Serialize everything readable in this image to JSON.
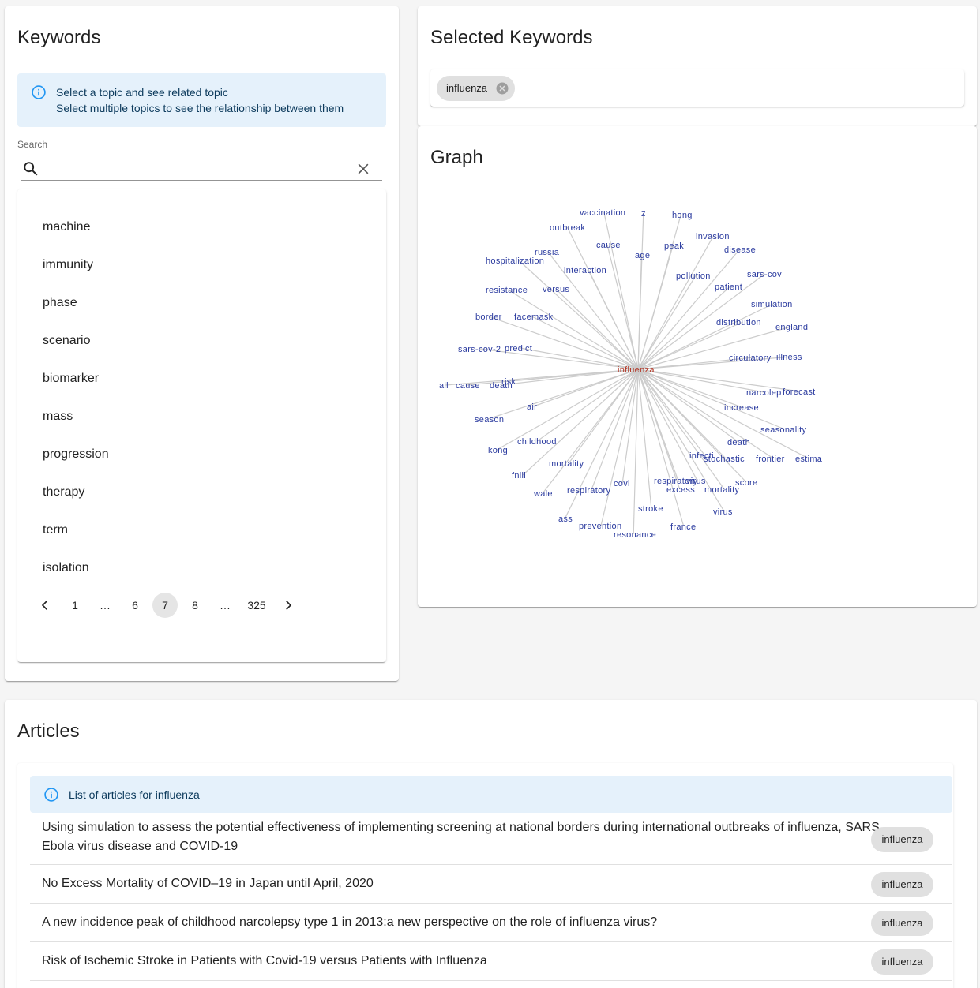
{
  "keywords_panel": {
    "title": "Keywords",
    "info_line1": "Select a topic and see related topic",
    "info_line2": "Select multiple topics to see the relationship between them",
    "search_label": "Search",
    "search_value": "",
    "items": [
      "machine",
      "immunity",
      "phase",
      "scenario",
      "biomarker",
      "mass",
      "progression",
      "therapy",
      "term",
      "isolation"
    ],
    "pagination": {
      "prev_icon": "chevron-left-icon",
      "next_icon": "chevron-right-icon",
      "pages": [
        "1",
        "…",
        "6",
        "7",
        "8",
        "…",
        "325"
      ],
      "current": "7"
    }
  },
  "selected_panel": {
    "title": "Selected Keywords",
    "chips": [
      "influenza"
    ]
  },
  "graph_panel": {
    "title": "Graph",
    "center": "influenza",
    "center_color": "#b23423",
    "node_color": "#2b3b9f",
    "edge_color": "#cccccc",
    "nodes": [
      "vaccination",
      "z",
      "hong",
      "outbreak",
      "invasion",
      "cause",
      "russia",
      "peak",
      "age",
      "disease",
      "hospitalization",
      "interaction",
      "pollution",
      "sars-cov",
      "patient",
      "resistance",
      "versus",
      "simulation",
      "border",
      "facemask",
      "distribution",
      "england",
      "sars-cov-2",
      "predict",
      "circulatory",
      "illness",
      "risk",
      "all",
      "cause",
      "death",
      "narcolep",
      "forecast",
      "air",
      "increase",
      "season",
      "seasonality",
      "childhood",
      "death",
      "kong",
      "infecti",
      "stochastic",
      "frontier",
      "estima",
      "mortality",
      "fnili",
      "respiratory",
      "virus",
      "covi",
      "score",
      "wale",
      "respiratory",
      "excess",
      "mortality",
      "stroke",
      "ass",
      "virus",
      "prevention",
      "france",
      "resonance"
    ]
  },
  "articles_panel": {
    "title": "Articles",
    "info": "List of articles for influenza",
    "articles": [
      {
        "title_line1": "Using simulation to assess the potential effectiveness of implementing screening at national borders during international outbreaks of influenza, SARS,",
        "title_line2": "Ebola virus disease and COVID-19",
        "tag": "influenza"
      },
      {
        "title_line1": "No Excess Mortality of COVID–19 in Japan until April, 2020",
        "title_line2": "",
        "tag": "influenza"
      },
      {
        "title_line1": "A new incidence peak of childhood narcolepsy type 1 in 2013:a new perspective on the role of influenza virus?",
        "title_line2": "",
        "tag": "influenza"
      },
      {
        "title_line1": "Risk of Ischemic Stroke in Patients with Covid-19 versus Patients with Influenza",
        "title_line2": "",
        "tag": "influenza"
      }
    ]
  }
}
